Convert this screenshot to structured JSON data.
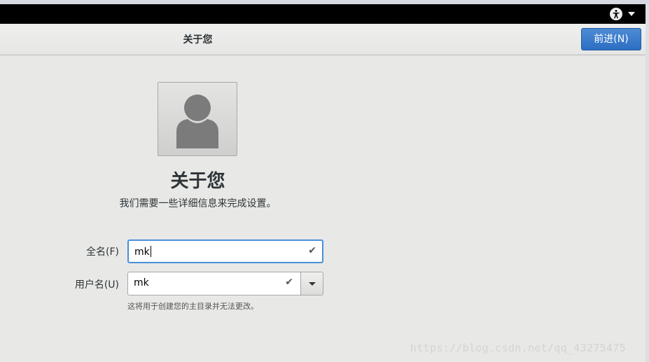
{
  "header": {
    "title": "关于您",
    "next_button_label": "前进(N)"
  },
  "main": {
    "title": "关于您",
    "subtitle": "我们需要一些详细信息来完成设置。",
    "fullname_label": "全名(F)",
    "fullname_value": "mk",
    "username_label": "用户名(U)",
    "username_value": "mk",
    "username_hint": "这将用于创建您的主目录并无法更改。"
  },
  "icons": {
    "accessibility": "accessibility-icon",
    "avatar": "user-avatar-icon",
    "check": "checkmark-icon",
    "dropdown": "chevron-down-icon"
  },
  "colors": {
    "topbar": "#000000",
    "primary_button": "#2c6ec3",
    "focus_border": "#4a90d9",
    "background": "#e8e8e7"
  },
  "watermark": "https://blog.csdn.net/qq_43275475"
}
